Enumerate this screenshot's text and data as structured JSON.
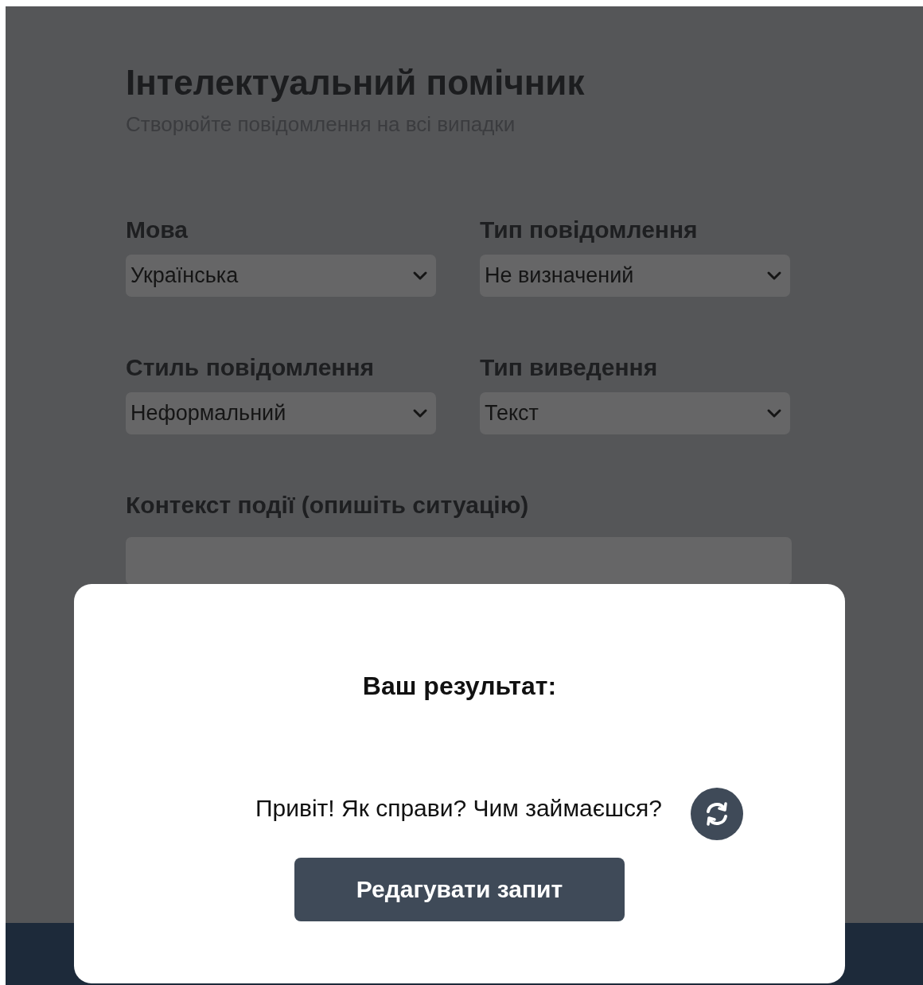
{
  "header": {
    "title": "Інтелектуальний помічник",
    "subtitle": "Створюйте повідомлення на всі випадки"
  },
  "fields": [
    {
      "label": "Мова",
      "value": "Українська"
    },
    {
      "label": "Тип повідомлення",
      "value": "Не визначений"
    },
    {
      "label": "Стиль повідомлення",
      "value": "Неформальний"
    },
    {
      "label": "Тип виведення",
      "value": "Текст"
    }
  ],
  "context": {
    "label": "Контекст події (опишіть ситуацію)"
  },
  "modal": {
    "title": "Ваш результат:",
    "result": "Привіт! Як справи? Чим займаєшся?",
    "button": "Редагувати запит"
  }
}
